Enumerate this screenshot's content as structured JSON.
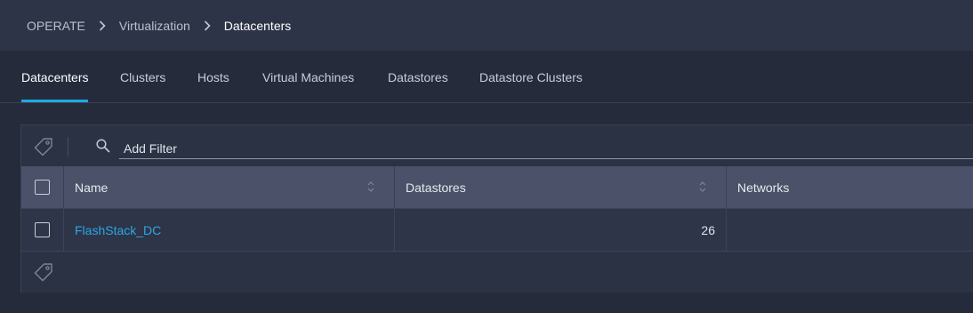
{
  "breadcrumb": {
    "items": [
      {
        "label": "OPERATE"
      },
      {
        "label": "Virtualization"
      },
      {
        "label": "Datacenters"
      }
    ]
  },
  "tabs": [
    {
      "label": "Datacenters",
      "active": true
    },
    {
      "label": "Clusters",
      "active": false
    },
    {
      "label": "Hosts",
      "active": false
    },
    {
      "label": "Virtual Machines",
      "active": false
    },
    {
      "label": "Datastores",
      "active": false
    },
    {
      "label": "Datastore Clusters",
      "active": false
    }
  ],
  "filter": {
    "placeholder": "Add Filter",
    "tag_icon": "tag-icon",
    "search_icon": "search-icon"
  },
  "table": {
    "columns": [
      {
        "label": "Name",
        "sortable": true
      },
      {
        "label": "Datastores",
        "sortable": true
      },
      {
        "label": "Networks",
        "sortable": false
      }
    ],
    "rows": [
      {
        "name": "FlashStack_DC",
        "datastores": "26",
        "networks": ""
      }
    ]
  },
  "colors": {
    "accent": "#1fa8e0",
    "link": "#2aa7e3",
    "background": "#252b3b",
    "header_bg": "#4a5168"
  }
}
